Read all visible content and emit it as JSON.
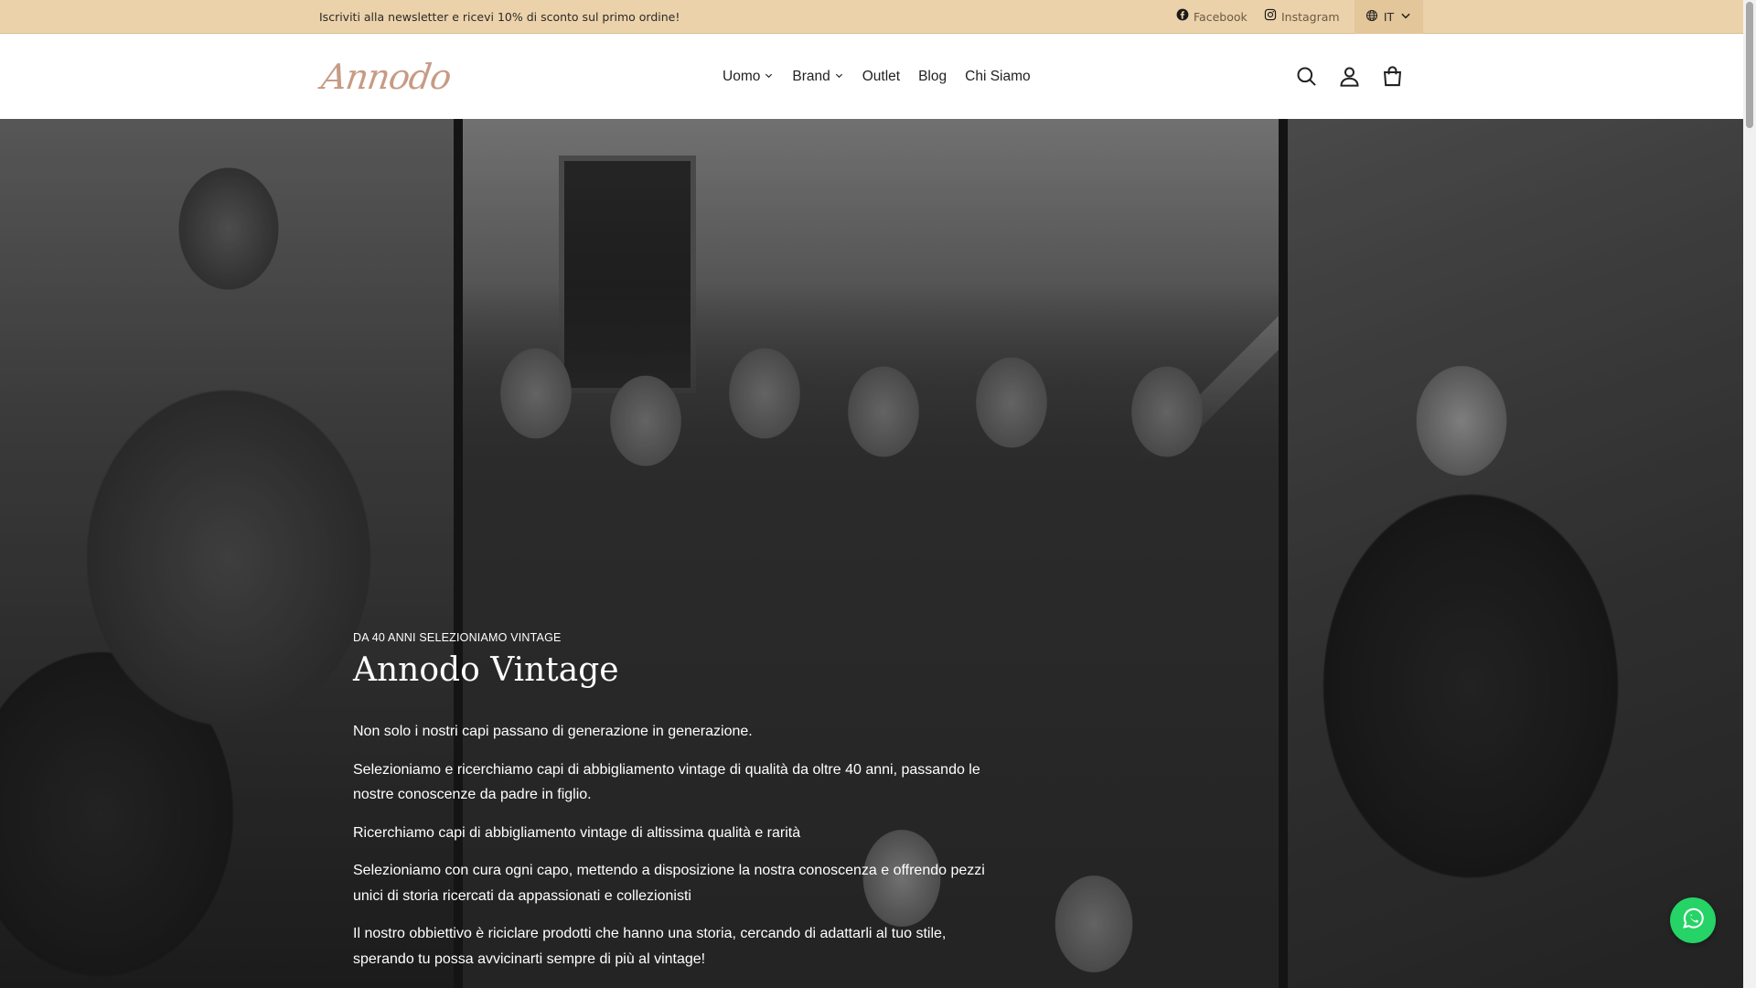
{
  "announcement": {
    "text": "Iscriviti alla newsletter e ricevi 10% di sconto sul primo ordine!",
    "facebook_label": "Facebook",
    "instagram_label": "Instagram",
    "language": "IT"
  },
  "header": {
    "logo_text": "Annodo",
    "nav": [
      {
        "label": "Uomo",
        "has_dropdown": true
      },
      {
        "label": "Brand",
        "has_dropdown": true
      },
      {
        "label": "Outlet",
        "has_dropdown": false
      },
      {
        "label": "Blog",
        "has_dropdown": false
      },
      {
        "label": "Chi Siamo",
        "has_dropdown": false
      }
    ],
    "icons": [
      "search-icon",
      "account-icon",
      "cart-icon"
    ]
  },
  "hero": {
    "eyebrow": "DA 40 ANNI SELEZIONIAMO VINTAGE",
    "title": "Annodo Vintage",
    "paragraphs": [
      "Non solo i nostri capi passano di generazione in generazione.",
      "Selezioniamo e ricerchiamo capi di abbigliamento vintage di qualità da oltre 40 anni, passando le nostre conoscenze da padre in figlio.",
      "Ricerchiamo capi di abbigliamento vintage di altissima qualità e rarità",
      "Selezioniamo con cura ogni capo, mettendo a disposizione la nostra conoscenza e offrendo pezzi unici di storia ricercati da appassionati e collezionisti",
      "Il nostro obbiettivo è riciclare prodotti che hanno una storia, cercando di adattarli al tuo stile, sperando tu possa avvicinarti sempre di più al vintage!"
    ]
  },
  "colors": {
    "announcement_bg": "#ecd2aa",
    "logo": "#c79b84",
    "whatsapp": "#25d366"
  }
}
